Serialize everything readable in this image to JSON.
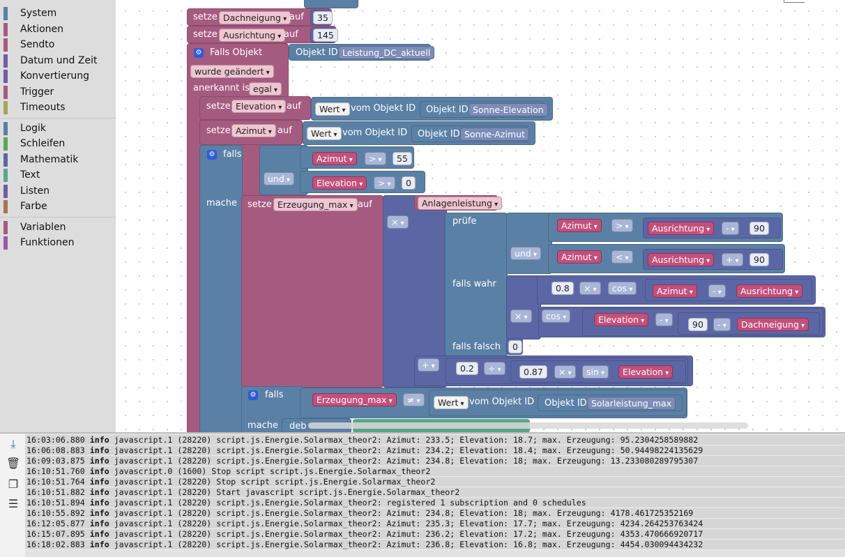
{
  "toolbox": {
    "groups": [
      [
        {
          "label": "System",
          "color": "#5b80a5"
        },
        {
          "label": "Aktionen",
          "color": "#a55b80"
        },
        {
          "label": "Sendto",
          "color": "#a55b80"
        },
        {
          "label": "Datum und Zeit",
          "color": "#745ba5"
        },
        {
          "label": "Konvertierung",
          "color": "#745ba5"
        },
        {
          "label": "Trigger",
          "color": "#a55b80"
        },
        {
          "label": "Timeouts",
          "color": "#a5a55b"
        }
      ],
      [
        {
          "label": "Logik",
          "color": "#5b80a5"
        },
        {
          "label": "Schleifen",
          "color": "#5ba55b"
        },
        {
          "label": "Mathematik",
          "color": "#5b67a5"
        },
        {
          "label": "Text",
          "color": "#5ba58c"
        },
        {
          "label": "Listen",
          "color": "#745ba5"
        },
        {
          "label": "Farbe",
          "color": "#a5745b"
        }
      ],
      [
        {
          "label": "Variablen",
          "color": "#a55b80"
        },
        {
          "label": "Funktionen",
          "color": "#995ba5"
        }
      ]
    ]
  },
  "blocks": {
    "setze": "setze",
    "auf": "auf",
    "dachneigung": "Dachneigung",
    "dachneigung_val": "35",
    "ausrichtung": "Ausrichtung",
    "ausrichtung_val": "145",
    "falls_objekt": "Falls Objekt",
    "objekt_id": "Objekt ID",
    "leistung_id": "Leistung_DC_aktuell",
    "wurde_geaendert": "wurde geändert",
    "anerkannt_ist": "anerkannt ist",
    "egal": "egal",
    "elevation": "Elevation",
    "azimut": "Azimut",
    "wert": "Wert",
    "vom_objekt_id": "vom Objekt ID",
    "sonne_elevation": "Sonne-Elevation",
    "sonne_azimut": "Sonne-Azimut",
    "falls": "falls",
    "und": "und",
    "mache": "mache",
    "gt": ">",
    "lt": "<",
    "ne": "≠",
    "n55": "55",
    "n0": "0",
    "erzeugung_max": "Erzeugung_max",
    "anlagenleistung": "Anlagenleistung",
    "times": "×",
    "pruefe": "prüfe",
    "minus": "-",
    "plus": "+",
    "div": "÷",
    "n90": "90",
    "falls_wahr": "falls wahr",
    "falls_falsch": "falls falsch",
    "n08": "0.8",
    "cos": "cos",
    "sin": "sin",
    "n02": "0.2",
    "n087": "0.87",
    "solarleistung_max": "Solarleistung_max",
    "debug": "deb"
  },
  "log": {
    "lines": [
      {
        "time": "16:03:06.880",
        "level": "info",
        "msg": "javascript.1 (28220) script.js.Energie.Solarmax_theor2: Azimut: 233.5; Elevation: 18.7; max. Erzeugung: 95.2304258589882"
      },
      {
        "time": "16:06:08.883",
        "level": "info",
        "msg": "javascript.1 (28220) script.js.Energie.Solarmax_theor2: Azimut: 234.2; Elevation: 18.4; max. Erzeugung: 50.94498224135629"
      },
      {
        "time": "16:09:03.875",
        "level": "info",
        "msg": "javascript.1 (28220) script.js.Energie.Solarmax_theor2: Azimut: 234.8; Elevation: 18; max. Erzeugung: 13.233080289795307"
      },
      {
        "time": "16:10:51.760",
        "level": "info",
        "msg": "javascript.0 (1600) Stop script script.js.Energie.Solarmax_theor2"
      },
      {
        "time": "16:10:51.764",
        "level": "info",
        "msg": "javascript.1 (28220) Stop script script.js.Energie.Solarmax_theor2"
      },
      {
        "time": "16:10:51.882",
        "level": "info",
        "msg": "javascript.1 (28220) Start javascript script.js.Energie.Solarmax_theor2"
      },
      {
        "time": "16:10:51.894",
        "level": "info",
        "msg": "javascript.1 (28220) script.js.Energie.Solarmax_theor2: registered 1 subscription and 0 schedules"
      },
      {
        "time": "16:10:55.892",
        "level": "info",
        "msg": "javascript.1 (28220) script.js.Energie.Solarmax_theor2: Azimut: 234.8; Elevation: 18; max. Erzeugung: 4178.461725352169"
      },
      {
        "time": "16:12:05.877",
        "level": "info",
        "msg": "javascript.1 (28220) script.js.Energie.Solarmax_theor2: Azimut: 235.3; Elevation: 17.7; max. Erzeugung: 4234.264253763424"
      },
      {
        "time": "16:15:07.895",
        "level": "info",
        "msg": "javascript.1 (28220) script.js.Energie.Solarmax_theor2: Azimut: 236.2; Elevation: 17.2; max. Erzeugung: 4353.470666920717"
      },
      {
        "time": "16:18:02.883",
        "level": "info",
        "msg": "javascript.1 (28220) script.js.Energie.Solarmax_theor2: Azimut: 236.8; Elevation: 16.8; max. Erzeugung: 4454.030094434232"
      }
    ]
  }
}
